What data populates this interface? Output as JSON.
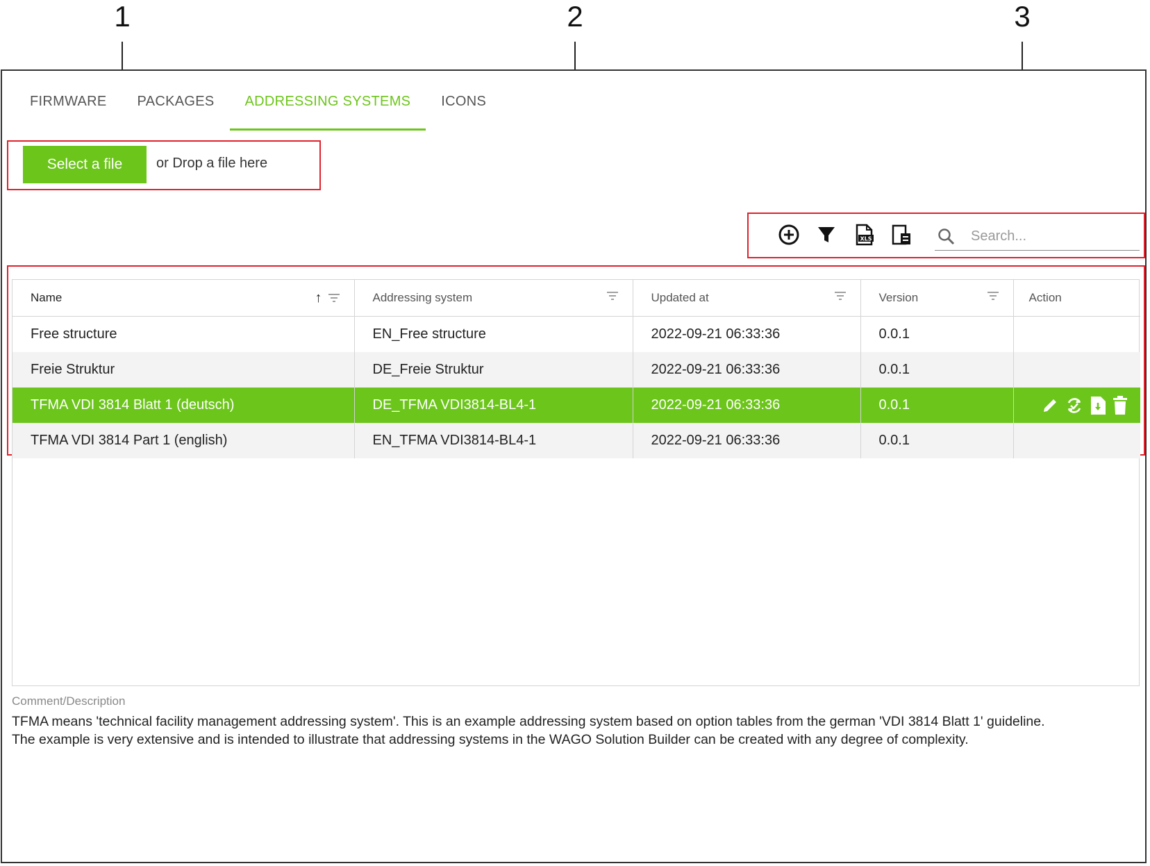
{
  "callouts": [
    "1",
    "2",
    "3"
  ],
  "tabs": [
    {
      "label": "FIRMWARE",
      "active": false
    },
    {
      "label": "PACKAGES",
      "active": false
    },
    {
      "label": "ADDRESSING SYSTEMS",
      "active": true
    },
    {
      "label": "ICONS",
      "active": false
    }
  ],
  "upload": {
    "button_label": "Select a file",
    "drop_text": "or Drop a file here"
  },
  "toolbar": {
    "icons": [
      "add-circle-icon",
      "filter-icon",
      "export-xls-icon",
      "export-document-icon",
      "search-icon"
    ],
    "search_placeholder": "Search..."
  },
  "table": {
    "columns": [
      "Name",
      "Addressing system",
      "Updated at",
      "Version",
      "Action"
    ],
    "sort": {
      "column": "Name",
      "direction": "ascending"
    },
    "rows": [
      [
        "Free structure",
        "EN_Free structure",
        "2022-09-21 06:33:36",
        "0.0.1"
      ],
      [
        "Freie Struktur",
        "DE_Freie Struktur",
        "2022-09-21 06:33:36",
        "0.0.1"
      ],
      [
        "TFMA VDI 3814 Blatt 1 (deutsch)",
        "DE_TFMA VDI3814-BL4-1",
        "2022-09-21 06:33:36",
        "0.0.1"
      ],
      [
        "TFMA VDI 3814 Part 1 (english)",
        "EN_TFMA VDI3814-BL4-1",
        "2022-09-21 06:33:36",
        "0.0.1"
      ]
    ],
    "selected_row": 2,
    "row_actions": [
      "edit-icon",
      "sync-icon",
      "download-icon",
      "delete-icon"
    ]
  },
  "comment": {
    "label": "Comment/Description",
    "line1": "TFMA means 'technical facility management addressing system'. This is an example addressing system based on option tables from the german 'VDI 3814 Blatt 1' guideline.",
    "line2": "The example is very extensive and is intended to illustrate that addressing systems in the WAGO Solution Builder can be created with any degree of complexity."
  },
  "colors": {
    "accent": "#6cc51a",
    "highlight_box": "#e0202a",
    "alt_row": "#f3f3f3"
  }
}
